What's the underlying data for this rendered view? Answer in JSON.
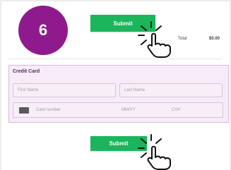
{
  "step": {
    "number": "6"
  },
  "top_submit": {
    "label": "Submit"
  },
  "summary": {
    "total_label": "Total",
    "total_value": "$0.00"
  },
  "credit_card": {
    "title": "Credit Card",
    "first_name_placeholder": "First Name",
    "last_name_placeholder": "Last Name",
    "card_number_placeholder": "Card number",
    "expiry_placeholder": "MM/YY",
    "cvv_placeholder": "CVV"
  },
  "bottom_submit": {
    "label": "Submit"
  },
  "colors": {
    "step_badge": "#8e1a8e",
    "submit_button": "#1bb55c",
    "card_panel_bg": "#f6ecf7",
    "card_panel_border": "#d9b8dc"
  }
}
